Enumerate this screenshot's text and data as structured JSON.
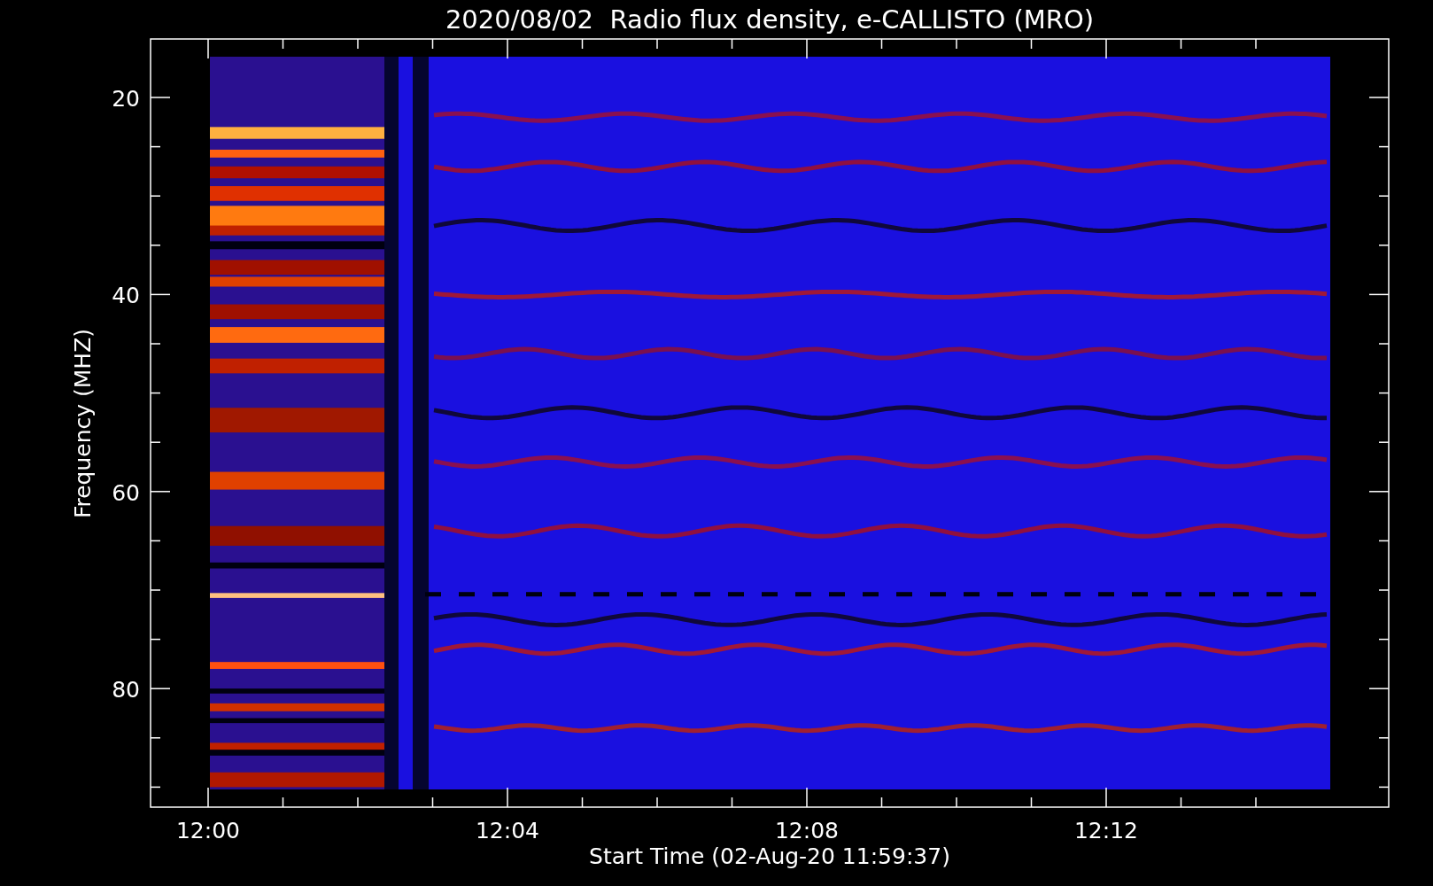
{
  "title": "2020/08/02  Radio flux density, e-CALLISTO (MRO)",
  "ylabel": "Frequency (MHZ)",
  "xlabel": "Start Time (02-Aug-20 11:59:37)",
  "y_ticks": [
    "20",
    "40",
    "60",
    "80"
  ],
  "x_ticks": [
    "12:00",
    "12:04",
    "12:08",
    "12:12"
  ]
}
